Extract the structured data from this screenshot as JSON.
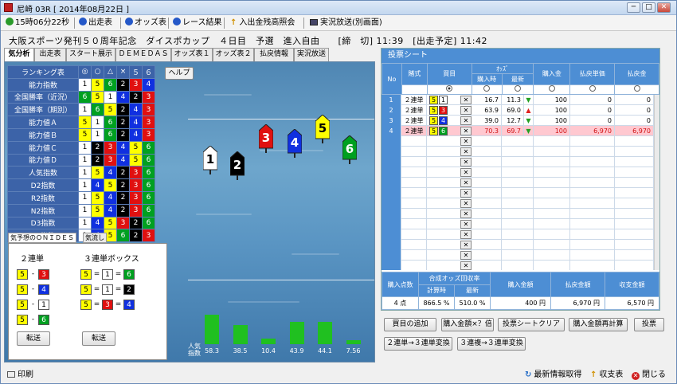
{
  "window": {
    "title": "尼崎 03R [ 2014年08月22日 ]",
    "min": "─",
    "max": "□",
    "close": "✕"
  },
  "toolbar": {
    "clock": "15時06分22秒",
    "items": [
      "出走表",
      "オッズ表",
      "レース結果",
      "入出金残高照会",
      "実況放送(別画面)"
    ]
  },
  "race": {
    "info": "大阪スポーツ発刊５０周年記念　ダイスポカップ　４日目　予選　進入自由　　[締　切] 11:39　[出走予定] 11:42"
  },
  "tabs": [
    "気分析",
    "出走表",
    "スタート展示",
    "ＤＥＭＥＤＡＳ",
    "オッズ表１",
    "オッズ表２",
    "払戻情報",
    "実況放送"
  ],
  "ranking": {
    "header": [
      "ランキング表",
      "◎",
      "○",
      "△",
      "×",
      "５",
      "６"
    ],
    "rows": [
      {
        "label": "能力指数",
        "nums": [
          1,
          5,
          6,
          2,
          3,
          4
        ]
      },
      {
        "label": "全国勝率（近況）",
        "nums": [
          6,
          5,
          1,
          4,
          2,
          3
        ]
      },
      {
        "label": "全国勝率（期別）",
        "nums": [
          1,
          6,
          5,
          2,
          4,
          3
        ]
      },
      {
        "label": "能力値Ａ",
        "nums": [
          5,
          1,
          6,
          2,
          4,
          3
        ]
      },
      {
        "label": "能力値Ｂ",
        "nums": [
          5,
          1,
          6,
          2,
          4,
          3
        ]
      },
      {
        "label": "能力値Ｃ",
        "nums": [
          1,
          2,
          3,
          4,
          5,
          6
        ]
      },
      {
        "label": "能力値Ｄ",
        "nums": [
          1,
          2,
          3,
          4,
          5,
          6
        ]
      },
      {
        "label": "人気指数",
        "nums": [
          1,
          5,
          4,
          2,
          3,
          6
        ]
      },
      {
        "label": "D2指数",
        "nums": [
          1,
          4,
          5,
          2,
          3,
          6
        ]
      },
      {
        "label": "R2指数",
        "nums": [
          1,
          5,
          4,
          2,
          3,
          6
        ]
      },
      {
        "label": "N2指数",
        "nums": [
          1,
          5,
          4,
          2,
          3,
          6
        ]
      },
      {
        "label": "D3指数",
        "nums": [
          1,
          4,
          5,
          3,
          2,
          6
        ]
      },
      {
        "label": "R3指数",
        "nums": [
          1,
          4,
          5,
          6,
          2,
          3
        ]
      }
    ],
    "help": "ヘルプ"
  },
  "boats": [
    1,
    2,
    3,
    4,
    5,
    6
  ],
  "popularity": {
    "label": "人気\n指数",
    "values": [
      58.3,
      38.5,
      10.4,
      43.9,
      44.1,
      7.56
    ],
    "labels": [
      "58.3",
      "38.5",
      "10.4",
      "43.9",
      "44.1",
      "7.56"
    ]
  },
  "onides": {
    "tab1": "気予想のＯＮＩＤＥＳ",
    "tab2": "気流し",
    "left_title": "２連単",
    "right_title": "３連単ボックス",
    "left": [
      [
        5,
        3
      ],
      [
        5,
        4
      ],
      [
        5,
        1
      ],
      [
        5,
        6
      ]
    ],
    "right": [
      [
        5,
        1,
        6
      ],
      [
        5,
        1,
        2
      ],
      [
        5,
        3,
        4
      ]
    ],
    "transfer": "転送"
  },
  "sheet": {
    "title": "投票シート",
    "h_no": "No",
    "h_type": "賭式",
    "h_target": "買目",
    "h_odds": "ｵｯｽﾞ",
    "h_buy_time": "購入時",
    "h_latest": "最新",
    "h_amount": "購入金",
    "h_payout_unit": "払戻単価",
    "h_payout": "払戻金",
    "rows": [
      {
        "no": "1",
        "type": "２連単",
        "a": 5,
        "b": 1,
        "buy": "16.7",
        "latest": "11.3",
        "dir": "down",
        "amount": "100",
        "unit": "0",
        "pay": "0"
      },
      {
        "no": "2",
        "type": "２連単",
        "a": 5,
        "b": 3,
        "buy": "63.9",
        "latest": "69.0",
        "dir": "up",
        "amount": "100",
        "unit": "0",
        "pay": "0"
      },
      {
        "no": "3",
        "type": "２連単",
        "a": 5,
        "b": 4,
        "buy": "39.0",
        "latest": "12.7",
        "dir": "down",
        "amount": "100",
        "unit": "0",
        "pay": "0"
      },
      {
        "no": "4",
        "type": "２連単",
        "a": 5,
        "b": 6,
        "buy": "70.3",
        "latest": "69.7",
        "dir": "down",
        "amount": "100",
        "unit": "6,970",
        "pay": "6,970"
      }
    ],
    "x": "✕",
    "summary": {
      "h_points": "購入点数",
      "h_combined": "合成オッズ回収率",
      "h_calc": "計算時",
      "h_latest": "最新",
      "h_purchase": "購入金額",
      "h_payout": "払戻金額",
      "h_balance": "収支金額",
      "points": "4 点",
      "calc": "866.5 %",
      "latest": "510.0 %",
      "purchase": "400 円",
      "payout": "6,970 円",
      "balance": "6,570 円"
    }
  },
  "actions": [
    "買目の追加",
    "購入金額×？倍",
    "投票シートクリア",
    "購入金額再計算",
    "投票",
    "２連単→３連単変換",
    "３連複→３連単変換"
  ],
  "footer": {
    "print": "印刷",
    "refresh": "最新情報取得",
    "ledger": "収支表",
    "close": "閉じる"
  }
}
